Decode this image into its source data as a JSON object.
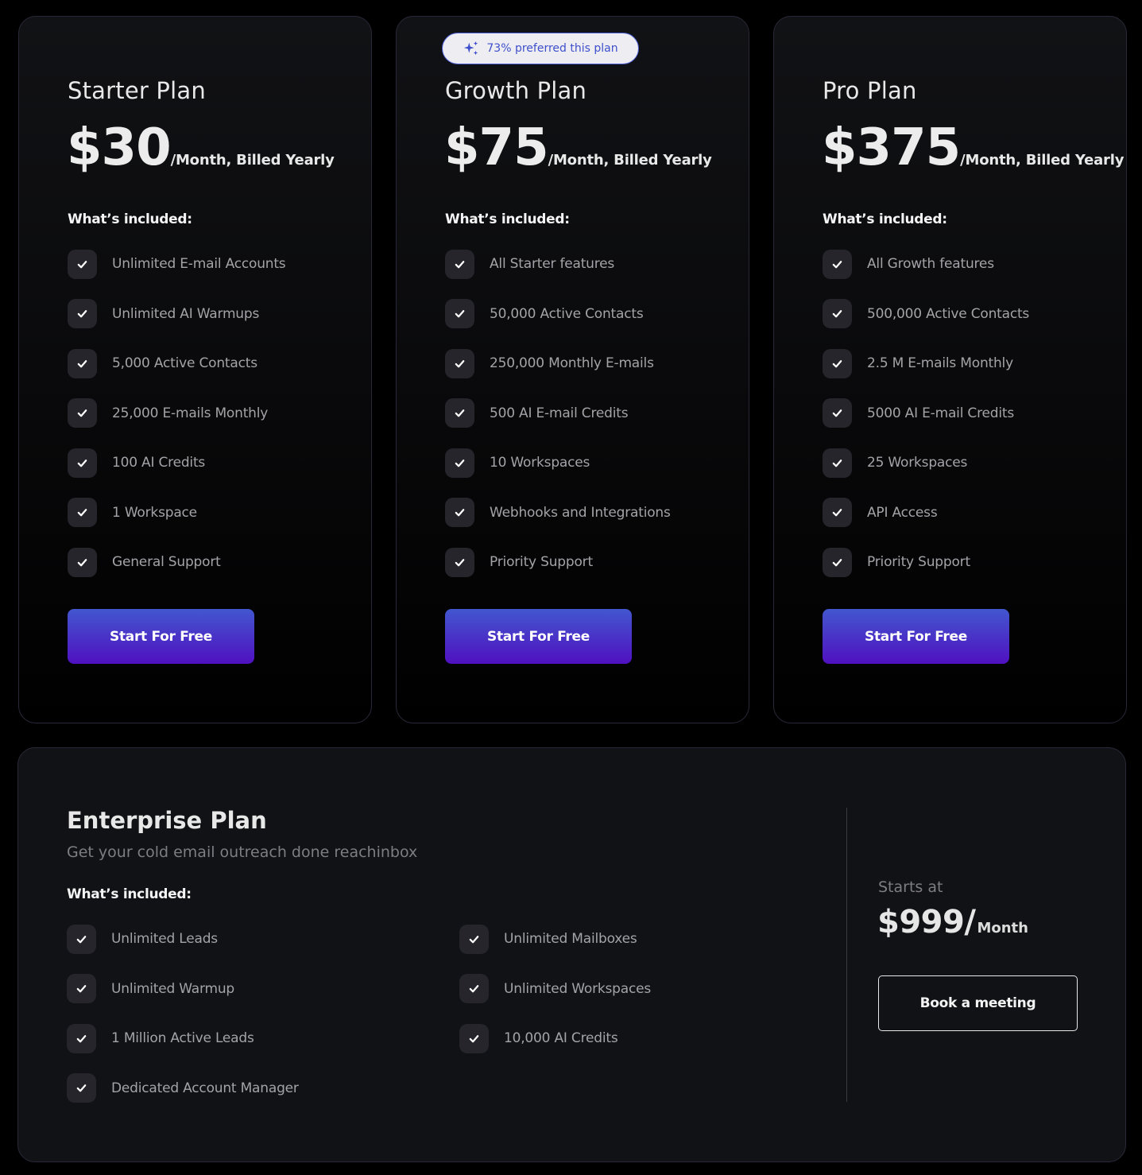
{
  "plans": [
    {
      "name": "Starter Plan",
      "price": "$30",
      "period": "/Month, Billed Yearly",
      "included_label": "What’s included:",
      "features": [
        "Unlimited E-mail Accounts",
        "Unlimited AI Warmups",
        "5,000 Active Contacts",
        "25,000 E-mails Monthly",
        "100 AI Credits",
        "1 Workspace",
        "General Support"
      ],
      "cta_label": "Start For Free"
    },
    {
      "name": "Growth Plan",
      "badge": "73% preferred this plan",
      "price": "$75",
      "period": "/Month, Billed Yearly",
      "included_label": "What’s included:",
      "features": [
        "All Starter features",
        "50,000 Active Contacts",
        "250,000 Monthly E-mails",
        "500 AI E-mail Credits",
        "10 Workspaces",
        "Webhooks and Integrations",
        "Priority Support"
      ],
      "cta_label": "Start For Free"
    },
    {
      "name": "Pro Plan",
      "price": "$375",
      "period": "/Month, Billed Yearly",
      "included_label": "What’s included:",
      "features": [
        "All Growth features",
        "500,000 Active Contacts",
        "2.5 M E-mails Monthly",
        "5000 AI E-mail Credits",
        "25 Workspaces",
        "API Access",
        "Priority Support"
      ],
      "cta_label": "Start For Free"
    }
  ],
  "enterprise": {
    "title": "Enterprise Plan",
    "subtitle": "Get your cold email outreach done reachinbox",
    "included_label": "What’s included:",
    "features_left": [
      "Unlimited Leads",
      "Unlimited Warmup",
      "1 Million Active Leads",
      "Dedicated Account Manager"
    ],
    "features_right": [
      "Unlimited Mailboxes",
      "Unlimited Workspaces",
      "10,000 AI Credits"
    ],
    "starts_label": "Starts at",
    "price": "$999/",
    "period": "Month",
    "cta_label": "Book a meeting"
  },
  "colors": {
    "cta_gradient_top": "#4257cf",
    "cta_gradient_bottom": "#5010c0",
    "badge_text": "#3f4fcc",
    "page_bg": "#000000",
    "card_bg": "#111215"
  }
}
